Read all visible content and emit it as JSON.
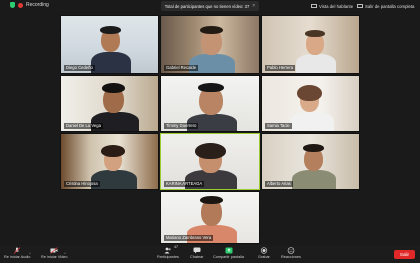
{
  "top": {
    "recording": "Recording",
    "participant_counter": "Total de participantes que no tienen vídeo: 37",
    "view_label": "Vista del hablante",
    "exit_fullscreen": "Salir de pantalla completa"
  },
  "participants": [
    {
      "name": "Diego Cedeño"
    },
    {
      "name": "Gabriel Recalde"
    },
    {
      "name": "Pablo Herrera"
    },
    {
      "name": "Daniel De La Vega"
    },
    {
      "name": "Timmy Guerrero"
    },
    {
      "name": "Samia Tacle"
    },
    {
      "name": "Cristina Hinojosa"
    },
    {
      "name": "KARINA ARTEAGA"
    },
    {
      "name": "Alberto Arias"
    },
    {
      "name": "Mariano Zambrano Vera"
    }
  ],
  "toolbar": {
    "start_audio": "Re iniciar Audio",
    "start_video": "Re iniciar Video",
    "participants": "Participantes",
    "participants_count": "47",
    "chat": "Chatear",
    "share_screen": "Compartir pantalla",
    "record": "Grabar",
    "reactions": "Reacciones",
    "leave": "Salir"
  },
  "colors": {
    "active_border": "#9acd32",
    "leave_button": "#e02828",
    "share_icon": "#2ecc71"
  }
}
